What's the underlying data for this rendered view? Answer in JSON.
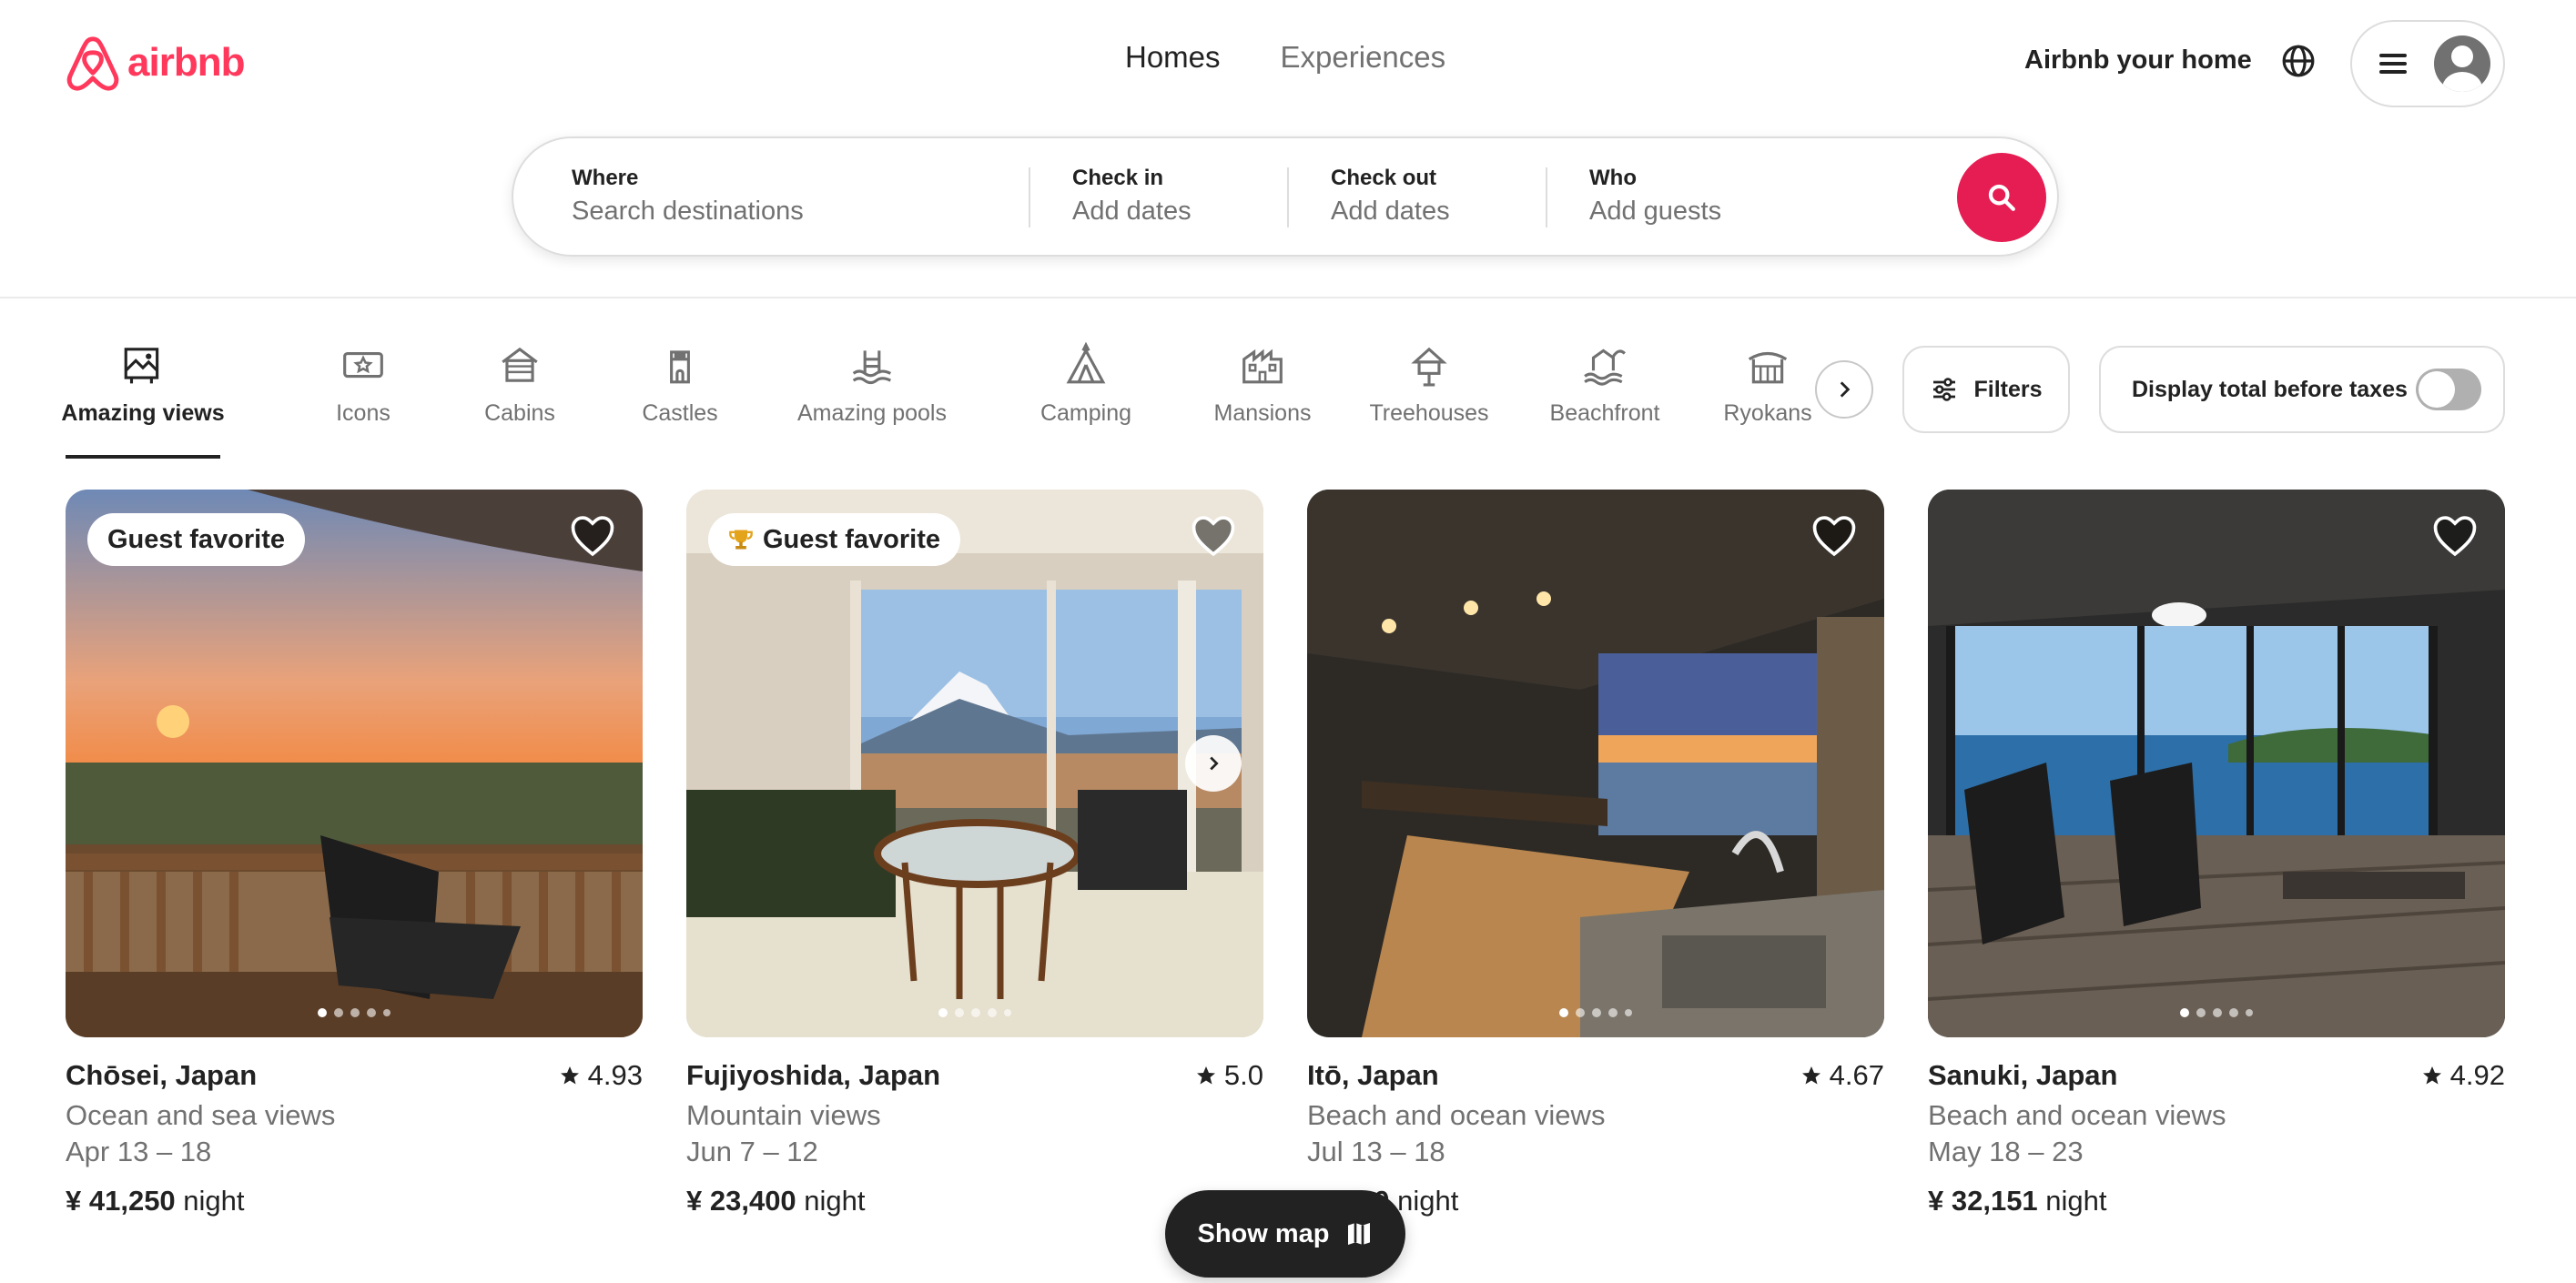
{
  "brand": {
    "name": "airbnb",
    "color": "#ff385c"
  },
  "nav": {
    "tabs": [
      {
        "label": "Homes",
        "active": true
      },
      {
        "label": "Experiences",
        "active": false
      }
    ]
  },
  "header": {
    "host_link": "Airbnb your home",
    "globe_icon": "globe-icon",
    "menu_icon": "hamburger-icon"
  },
  "search": {
    "where": {
      "label": "Where",
      "placeholder": "Search destinations"
    },
    "checkin": {
      "label": "Check in",
      "placeholder": "Add dates"
    },
    "checkout": {
      "label": "Check out",
      "placeholder": "Add dates"
    },
    "who": {
      "label": "Who",
      "placeholder": "Add guests"
    },
    "button_color": "#e51d53"
  },
  "categories": [
    {
      "label": "Amazing views",
      "icon": "amazing-views-icon",
      "active": true
    },
    {
      "label": "Icons",
      "icon": "icons-icon",
      "active": false
    },
    {
      "label": "Cabins",
      "icon": "cabins-icon",
      "active": false
    },
    {
      "label": "Castles",
      "icon": "castles-icon",
      "active": false
    },
    {
      "label": "Amazing pools",
      "icon": "pools-icon",
      "active": false
    },
    {
      "label": "Camping",
      "icon": "camping-icon",
      "active": false
    },
    {
      "label": "Mansions",
      "icon": "mansions-icon",
      "active": false
    },
    {
      "label": "Treehouses",
      "icon": "treehouses-icon",
      "active": false
    },
    {
      "label": "Beachfront",
      "icon": "beachfront-icon",
      "active": false
    },
    {
      "label": "Ryokans",
      "icon": "ryokans-icon",
      "active": false
    }
  ],
  "filters": {
    "label": "Filters"
  },
  "taxes": {
    "label": "Display total before taxes",
    "enabled": false
  },
  "listings": [
    {
      "badge": "Guest favorite",
      "trophy": false,
      "location": "Chōsei, Japan",
      "rating": "4.93",
      "description": "Ocean and sea views",
      "dates": "Apr 13 – 18",
      "price": "¥ 41,250",
      "price_unit": "night"
    },
    {
      "badge": "Guest favorite",
      "trophy": true,
      "location": "Fujiyoshida, Japan",
      "rating": "5.0",
      "description": "Mountain views",
      "dates": "Jun 7 – 12",
      "price": "¥ 23,400",
      "price_unit": "night"
    },
    {
      "badge": "",
      "trophy": false,
      "location": "Itō, Japan",
      "rating": "4.67",
      "description": "Beach and ocean views",
      "dates": "Jul 13 – 18",
      "price": "00",
      "price_unit": "night"
    },
    {
      "badge": "",
      "trophy": false,
      "location": "Sanuki, Japan",
      "rating": "4.92",
      "description": "Beach and ocean views",
      "dates": "May 18 – 23",
      "price": "¥ 32,151",
      "price_unit": "night"
    }
  ],
  "show_map": {
    "label": "Show map"
  }
}
